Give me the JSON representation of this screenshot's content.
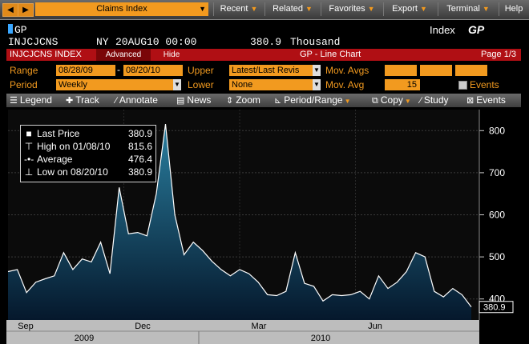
{
  "toolbar": {
    "back_icon": "back-arrow-icon",
    "forward_icon": "forward-arrow-icon",
    "title": "Claims Index",
    "menus": [
      "Recent",
      "Related",
      "Favorites",
      "Export",
      "Terminal",
      "Help"
    ]
  },
  "header": {
    "ticker_prefix": "GP",
    "index_label": "Index",
    "index_function": "GP",
    "ticker": "INJCJCNS",
    "location": "NY",
    "date_time": "20AUG10 00:00",
    "price": "380.9",
    "unit": "Thousand"
  },
  "panel": {
    "name": "INJCJCNS INDEX",
    "advanced_label": "Advanced",
    "hide_label": "Hide",
    "chart_title": "GP - Line Chart",
    "page": "Page 1/3"
  },
  "params": {
    "range_label": "Range",
    "range_start": "08/28/09",
    "range_sep": "-",
    "range_end": "08/20/10",
    "upper_label": "Upper",
    "upper_value": "Latest/Last Revis",
    "mov_avgs_label": "Mov. Avgs",
    "period_label": "Period",
    "period_value": "Weekly",
    "lower_label": "Lower",
    "lower_value": "None",
    "mov_avg_label": "Mov. Avg",
    "mov_avg_value": "15",
    "events_label": "Events"
  },
  "chart_tools": {
    "legend": "Legend",
    "track": "Track",
    "annotate": "Annotate",
    "news": "News",
    "zoom": "Zoom",
    "period_range": "Period/Range",
    "copy": "Copy",
    "study": "Study",
    "events": "Events"
  },
  "legend": {
    "last_label": "Last Price",
    "last_value": "380.9",
    "high_label": "High on 01/08/10",
    "high_value": "815.6",
    "avg_label": "Average",
    "avg_value": "476.4",
    "low_label": "Low on 08/20/10",
    "low_value": "380.9"
  },
  "colors": {
    "accent": "#f29a1f",
    "header_red": "#b00f14",
    "line": "#ffffff",
    "fill_top": "#1f6f8f",
    "fill_bottom": "#06223a"
  },
  "chart_data": {
    "type": "area",
    "ylim": [
      350,
      850
    ],
    "y_ticks": [
      400,
      500,
      600,
      700,
      800
    ],
    "last_label": "380.9",
    "x_month_labels": [
      "Sep",
      "Dec",
      "Mar",
      "Jun"
    ],
    "x_year_labels": [
      "2009",
      "2010"
    ],
    "grid": true,
    "series": [
      {
        "values": [
          465,
          470,
          415,
          440,
          448,
          455,
          510,
          470,
          495,
          488,
          535,
          460,
          665,
          555,
          558,
          550,
          650,
          815.6,
          600,
          505,
          535,
          515,
          490,
          470,
          455,
          470,
          460,
          440,
          410,
          408,
          418,
          510,
          437,
          430,
          395,
          410,
          408,
          410,
          418,
          400,
          455,
          425,
          440,
          465,
          510,
          500,
          418,
          405,
          425,
          410,
          380.9
        ]
      }
    ]
  }
}
